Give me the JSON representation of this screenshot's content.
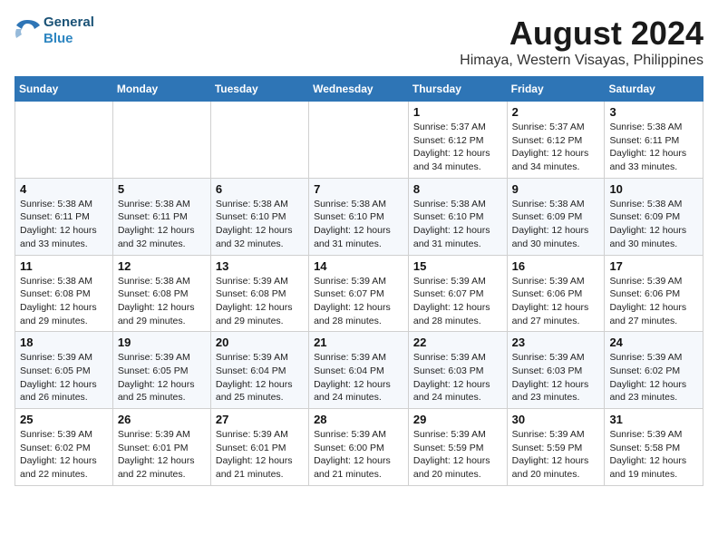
{
  "logo": {
    "line1": "General",
    "line2": "Blue"
  },
  "header": {
    "month": "August 2024",
    "location": "Himaya, Western Visayas, Philippines"
  },
  "days_of_week": [
    "Sunday",
    "Monday",
    "Tuesday",
    "Wednesday",
    "Thursday",
    "Friday",
    "Saturday"
  ],
  "weeks": [
    [
      {
        "day": "",
        "info": ""
      },
      {
        "day": "",
        "info": ""
      },
      {
        "day": "",
        "info": ""
      },
      {
        "day": "",
        "info": ""
      },
      {
        "day": "1",
        "sunrise": "Sunrise: 5:37 AM",
        "sunset": "Sunset: 6:12 PM",
        "daylight": "Daylight: 12 hours and 34 minutes."
      },
      {
        "day": "2",
        "sunrise": "Sunrise: 5:37 AM",
        "sunset": "Sunset: 6:12 PM",
        "daylight": "Daylight: 12 hours and 34 minutes."
      },
      {
        "day": "3",
        "sunrise": "Sunrise: 5:38 AM",
        "sunset": "Sunset: 6:11 PM",
        "daylight": "Daylight: 12 hours and 33 minutes."
      }
    ],
    [
      {
        "day": "4",
        "sunrise": "Sunrise: 5:38 AM",
        "sunset": "Sunset: 6:11 PM",
        "daylight": "Daylight: 12 hours and 33 minutes."
      },
      {
        "day": "5",
        "sunrise": "Sunrise: 5:38 AM",
        "sunset": "Sunset: 6:11 PM",
        "daylight": "Daylight: 12 hours and 32 minutes."
      },
      {
        "day": "6",
        "sunrise": "Sunrise: 5:38 AM",
        "sunset": "Sunset: 6:10 PM",
        "daylight": "Daylight: 12 hours and 32 minutes."
      },
      {
        "day": "7",
        "sunrise": "Sunrise: 5:38 AM",
        "sunset": "Sunset: 6:10 PM",
        "daylight": "Daylight: 12 hours and 31 minutes."
      },
      {
        "day": "8",
        "sunrise": "Sunrise: 5:38 AM",
        "sunset": "Sunset: 6:10 PM",
        "daylight": "Daylight: 12 hours and 31 minutes."
      },
      {
        "day": "9",
        "sunrise": "Sunrise: 5:38 AM",
        "sunset": "Sunset: 6:09 PM",
        "daylight": "Daylight: 12 hours and 30 minutes."
      },
      {
        "day": "10",
        "sunrise": "Sunrise: 5:38 AM",
        "sunset": "Sunset: 6:09 PM",
        "daylight": "Daylight: 12 hours and 30 minutes."
      }
    ],
    [
      {
        "day": "11",
        "sunrise": "Sunrise: 5:38 AM",
        "sunset": "Sunset: 6:08 PM",
        "daylight": "Daylight: 12 hours and 29 minutes."
      },
      {
        "day": "12",
        "sunrise": "Sunrise: 5:38 AM",
        "sunset": "Sunset: 6:08 PM",
        "daylight": "Daylight: 12 hours and 29 minutes."
      },
      {
        "day": "13",
        "sunrise": "Sunrise: 5:39 AM",
        "sunset": "Sunset: 6:08 PM",
        "daylight": "Daylight: 12 hours and 29 minutes."
      },
      {
        "day": "14",
        "sunrise": "Sunrise: 5:39 AM",
        "sunset": "Sunset: 6:07 PM",
        "daylight": "Daylight: 12 hours and 28 minutes."
      },
      {
        "day": "15",
        "sunrise": "Sunrise: 5:39 AM",
        "sunset": "Sunset: 6:07 PM",
        "daylight": "Daylight: 12 hours and 28 minutes."
      },
      {
        "day": "16",
        "sunrise": "Sunrise: 5:39 AM",
        "sunset": "Sunset: 6:06 PM",
        "daylight": "Daylight: 12 hours and 27 minutes."
      },
      {
        "day": "17",
        "sunrise": "Sunrise: 5:39 AM",
        "sunset": "Sunset: 6:06 PM",
        "daylight": "Daylight: 12 hours and 27 minutes."
      }
    ],
    [
      {
        "day": "18",
        "sunrise": "Sunrise: 5:39 AM",
        "sunset": "Sunset: 6:05 PM",
        "daylight": "Daylight: 12 hours and 26 minutes."
      },
      {
        "day": "19",
        "sunrise": "Sunrise: 5:39 AM",
        "sunset": "Sunset: 6:05 PM",
        "daylight": "Daylight: 12 hours and 25 minutes."
      },
      {
        "day": "20",
        "sunrise": "Sunrise: 5:39 AM",
        "sunset": "Sunset: 6:04 PM",
        "daylight": "Daylight: 12 hours and 25 minutes."
      },
      {
        "day": "21",
        "sunrise": "Sunrise: 5:39 AM",
        "sunset": "Sunset: 6:04 PM",
        "daylight": "Daylight: 12 hours and 24 minutes."
      },
      {
        "day": "22",
        "sunrise": "Sunrise: 5:39 AM",
        "sunset": "Sunset: 6:03 PM",
        "daylight": "Daylight: 12 hours and 24 minutes."
      },
      {
        "day": "23",
        "sunrise": "Sunrise: 5:39 AM",
        "sunset": "Sunset: 6:03 PM",
        "daylight": "Daylight: 12 hours and 23 minutes."
      },
      {
        "day": "24",
        "sunrise": "Sunrise: 5:39 AM",
        "sunset": "Sunset: 6:02 PM",
        "daylight": "Daylight: 12 hours and 23 minutes."
      }
    ],
    [
      {
        "day": "25",
        "sunrise": "Sunrise: 5:39 AM",
        "sunset": "Sunset: 6:02 PM",
        "daylight": "Daylight: 12 hours and 22 minutes."
      },
      {
        "day": "26",
        "sunrise": "Sunrise: 5:39 AM",
        "sunset": "Sunset: 6:01 PM",
        "daylight": "Daylight: 12 hours and 22 minutes."
      },
      {
        "day": "27",
        "sunrise": "Sunrise: 5:39 AM",
        "sunset": "Sunset: 6:01 PM",
        "daylight": "Daylight: 12 hours and 21 minutes."
      },
      {
        "day": "28",
        "sunrise": "Sunrise: 5:39 AM",
        "sunset": "Sunset: 6:00 PM",
        "daylight": "Daylight: 12 hours and 21 minutes."
      },
      {
        "day": "29",
        "sunrise": "Sunrise: 5:39 AM",
        "sunset": "Sunset: 5:59 PM",
        "daylight": "Daylight: 12 hours and 20 minutes."
      },
      {
        "day": "30",
        "sunrise": "Sunrise: 5:39 AM",
        "sunset": "Sunset: 5:59 PM",
        "daylight": "Daylight: 12 hours and 20 minutes."
      },
      {
        "day": "31",
        "sunrise": "Sunrise: 5:39 AM",
        "sunset": "Sunset: 5:58 PM",
        "daylight": "Daylight: 12 hours and 19 minutes."
      }
    ]
  ]
}
